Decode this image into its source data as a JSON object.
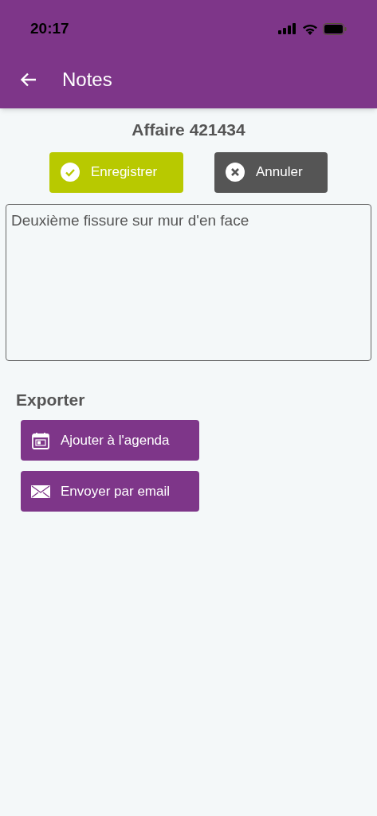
{
  "status_bar": {
    "time": "20:17"
  },
  "app_bar": {
    "title": "Notes"
  },
  "heading": "Affaire 421434",
  "actions": [
    {
      "kind": "save",
      "label": "Enregistrer"
    },
    {
      "kind": "cancel",
      "label": "Annuler"
    }
  ],
  "note": {
    "value": "Deuxième fissure sur mur d'en face"
  },
  "export": {
    "title": "Exporter",
    "buttons": [
      {
        "kind": "calendar",
        "label": "Ajouter à l'agenda"
      },
      {
        "kind": "email",
        "label": "Envoyer par email"
      }
    ]
  }
}
